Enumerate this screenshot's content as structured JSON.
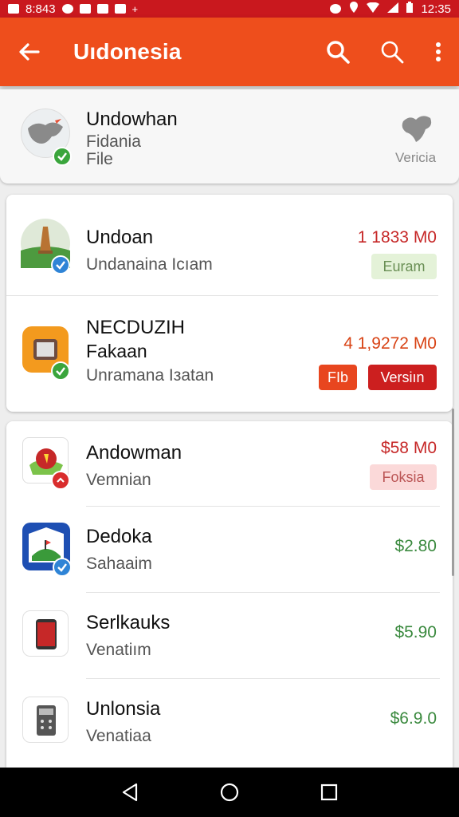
{
  "status_bar": {
    "time_left": "8:843",
    "time_right": "12:35"
  },
  "app_bar": {
    "title": "Uıdonesia"
  },
  "header": {
    "title": "Undowhan",
    "subtitle": "Fidania",
    "caption": "File",
    "right_label": "Vericia"
  },
  "section1": {
    "items": [
      {
        "title": "Undoan",
        "subtitle": "Undanaina Icıam",
        "price": "1 1833 M0",
        "chip": "Euram"
      },
      {
        "title": "NECDUZIH",
        "subtitle2": "Fakaan",
        "subtitle": "Unramana Iзatan",
        "price": "4 1,9272 M0",
        "chip_a": "FIb",
        "chip_b": "Versiın"
      }
    ]
  },
  "section2": {
    "items": [
      {
        "title": "Andowman",
        "subtitle": "Vemnian",
        "price": "$58 M0",
        "chip": "Foksia"
      },
      {
        "title": "Dedoka",
        "subtitle": "Sahaaim",
        "price": "$2.80"
      },
      {
        "title": "Serlkauks",
        "subtitle": "Venatiım",
        "price": "$5.90"
      },
      {
        "title": "Unlonsia",
        "subtitle": "Venatiaa",
        "price": "$6.9.0"
      }
    ]
  },
  "colors": {
    "app_bar": "#ee4e1c",
    "status_bar": "#c9181e",
    "price_red": "#c62828",
    "price_green": "#3b8a3f"
  }
}
